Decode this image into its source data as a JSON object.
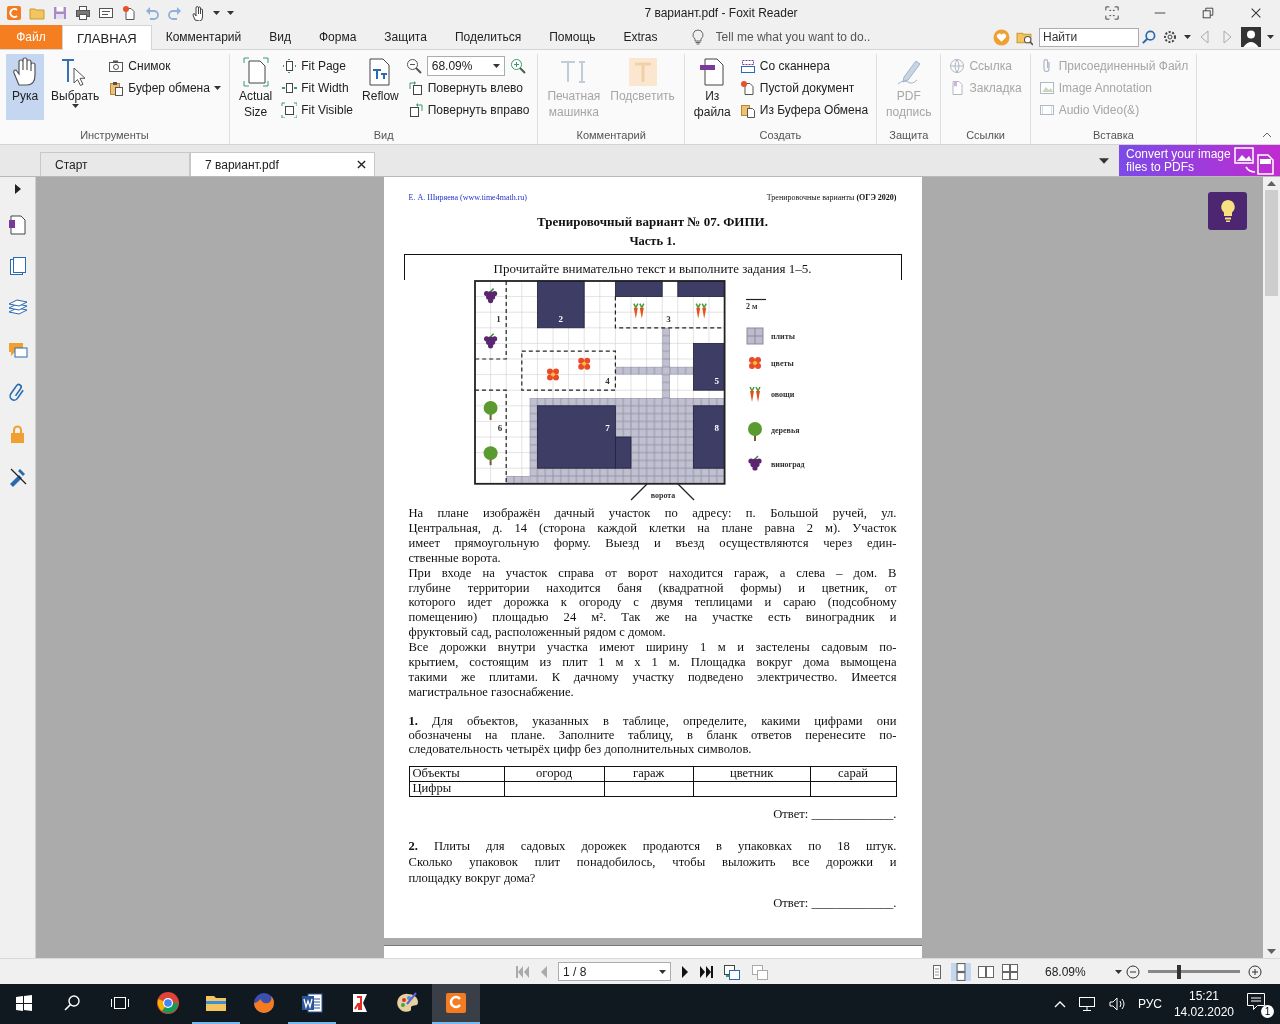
{
  "window": {
    "title": "7 вариант.pdf - Foxit Reader"
  },
  "menu_tabs": [
    {
      "label": "Файл",
      "kind": "file",
      "selected": false
    },
    {
      "label": "ГЛАВНАЯ",
      "kind": "tab",
      "selected": true
    },
    {
      "label": "Комментарий",
      "kind": "tab",
      "selected": false
    },
    {
      "label": "Вид",
      "kind": "tab",
      "selected": false
    },
    {
      "label": "Форма",
      "kind": "tab",
      "selected": false
    },
    {
      "label": "Защита",
      "kind": "tab",
      "selected": false
    },
    {
      "label": "Поделиться",
      "kind": "tab",
      "selected": false
    },
    {
      "label": "Помощь",
      "kind": "tab",
      "selected": false
    },
    {
      "label": "Extras",
      "kind": "tab",
      "selected": false
    }
  ],
  "tell_me": {
    "placeholder": "Tell me what you want to do.."
  },
  "search": {
    "placeholder": "Найти"
  },
  "ribbon_groups": [
    {
      "label": "Инструменты",
      "columns": [
        {
          "kind": "large",
          "items": [
            {
              "kind": "button",
              "label": "Рука",
              "selected": true,
              "disabled": false,
              "dropdown": false
            }
          ]
        },
        {
          "kind": "large",
          "items": [
            {
              "kind": "button",
              "label": "Выбрать",
              "selected": false,
              "disabled": false,
              "dropdown": true
            }
          ]
        },
        {
          "kind": "small",
          "items": [
            {
              "kind": "button",
              "label": "Снимок",
              "selected": false,
              "disabled": false,
              "dropdown": false
            },
            {
              "kind": "button",
              "label": "Буфер обмена",
              "selected": false,
              "disabled": false,
              "dropdown": true
            }
          ]
        }
      ]
    },
    {
      "label": "Вид",
      "columns": [
        {
          "kind": "large",
          "items": [
            {
              "kind": "button",
              "label": "Actual Size",
              "selected": false,
              "disabled": false,
              "dropdown": false
            }
          ]
        },
        {
          "kind": "small",
          "items": [
            {
              "kind": "button",
              "label": "Fit Page",
              "selected": false,
              "disabled": false,
              "dropdown": false
            },
            {
              "kind": "button",
              "label": "Fit Width",
              "selected": false,
              "disabled": false,
              "dropdown": false
            },
            {
              "kind": "button",
              "label": "Fit Visible",
              "selected": false,
              "disabled": false,
              "dropdown": false
            }
          ]
        },
        {
          "kind": "large",
          "items": [
            {
              "kind": "button",
              "label": "Reflow",
              "selected": false,
              "disabled": false,
              "dropdown": false
            }
          ]
        },
        {
          "kind": "small",
          "items": [
            {
              "kind": "combo",
              "value": "68.09%"
            },
            {
              "kind": "button",
              "label": "Повернуть влево",
              "selected": false,
              "disabled": false,
              "dropdown": false
            },
            {
              "kind": "button",
              "label": "Повернуть вправо",
              "selected": false,
              "disabled": false,
              "dropdown": false
            }
          ]
        }
      ]
    },
    {
      "label": "Комментарий",
      "columns": [
        {
          "kind": "large",
          "items": [
            {
              "kind": "button",
              "label": "Печатная машинка",
              "selected": false,
              "disabled": true,
              "dropdown": false
            }
          ]
        },
        {
          "kind": "large",
          "items": [
            {
              "kind": "button",
              "label": "Подсветить",
              "selected": false,
              "disabled": true,
              "dropdown": false
            }
          ]
        }
      ]
    },
    {
      "label": "Создать",
      "columns": [
        {
          "kind": "large",
          "items": [
            {
              "kind": "button",
              "label": "Из файла",
              "selected": false,
              "disabled": false,
              "dropdown": false
            }
          ]
        },
        {
          "kind": "small",
          "items": [
            {
              "kind": "button",
              "label": "Со сканнера",
              "selected": false,
              "disabled": false,
              "dropdown": false
            },
            {
              "kind": "button",
              "label": "Пустой документ",
              "selected": false,
              "disabled": false,
              "dropdown": false
            },
            {
              "kind": "button",
              "label": "Из Буфера Обмена",
              "selected": false,
              "disabled": false,
              "dropdown": false
            }
          ]
        }
      ]
    },
    {
      "label": "Защита",
      "columns": [
        {
          "kind": "large",
          "items": [
            {
              "kind": "button",
              "label": "PDF подпись",
              "selected": false,
              "disabled": true,
              "dropdown": false
            }
          ]
        }
      ]
    },
    {
      "label": "Ссылки",
      "columns": [
        {
          "kind": "small",
          "items": [
            {
              "kind": "button",
              "label": "Ссылка",
              "selected": false,
              "disabled": true,
              "dropdown": false
            },
            {
              "kind": "button",
              "label": "Закладка",
              "selected": false,
              "disabled": true,
              "dropdown": false
            }
          ]
        }
      ]
    },
    {
      "label": "Вставка",
      "columns": [
        {
          "kind": "small",
          "items": [
            {
              "kind": "button",
              "label": "Присоединенный Файл",
              "selected": false,
              "disabled": true,
              "dropdown": false
            },
            {
              "kind": "button",
              "label": "Image Annotation",
              "selected": false,
              "disabled": true,
              "dropdown": false
            },
            {
              "kind": "button",
              "label": "Audio  Video(&)",
              "selected": false,
              "disabled": true,
              "dropdown": false
            }
          ]
        }
      ]
    }
  ],
  "doc_tabs": [
    {
      "label": "Старт",
      "selected": false,
      "closable": false
    },
    {
      "label": "7 вариант.pdf",
      "selected": true,
      "closable": true
    }
  ],
  "promo": {
    "text": "Convert your image files to PDFs"
  },
  "document": {
    "header_left": "Е. А. Ширяева (www.time4math.ru)",
    "header_right": "Тренировочные варианты **(ОГЭ 2020)**",
    "title": "Тренировочный вариант № 07. ФИПИ.",
    "part": "Часть 1.",
    "instruction": "Прочитайте внимательно текст и выполните задания 1–5.",
    "plan": {
      "labels": [
        "1",
        "2",
        "3",
        "4",
        "5",
        "6",
        "7",
        "8"
      ],
      "gate": "ворота",
      "scale": "2 м",
      "legend": [
        {
          "kind": "tiles",
          "label": "плиты"
        },
        {
          "kind": "flowers",
          "label": "цветы"
        },
        {
          "kind": "vegetables",
          "label": "овощи"
        },
        {
          "kind": "trees",
          "label": "деревья"
        },
        {
          "kind": "grapes",
          "label": "виноград"
        }
      ]
    },
    "body": [
      {
        "kind": "paragraph",
        "lines": [
          "На плане изображён дачный участок по адресу: п. Большой ручей, ул.",
          "Центральная, д. 14 (сторона каждой клетки на плане равна 2 м). Участок",
          "имеет прямоугольную форму. Выезд и въезд осуществляются через един-",
          "ственные ворота."
        ]
      },
      {
        "kind": "paragraph",
        "lines": [
          "При входе на участок справа от ворот находится гараж, а слева – дом. В",
          "глубине территории находится баня (квадратной формы) и цветник, от",
          "которого идет дорожка к огороду с двумя теплицами и сараю (подсобному",
          "помещению) площадью 24 м². Так же на участке есть виноградник и",
          "фруктовый сад, расположенный рядом с домом."
        ]
      },
      {
        "kind": "paragraph",
        "lines": [
          "Все дорожки внутри участка имеют ширину 1 м и застелены садовым по-",
          "крытием, состоящим из плит 1 м х 1 м. Площадка вокруг дома вымощена",
          "такими же плитами. К дачному участку подведено электричество. Имеется",
          "магистральное газоснабжение."
        ]
      },
      {
        "kind": "question",
        "lines": [
          "**1.** Для объектов, указанных в таблице, определите, какими цифрами они",
          "обозначены на плане. Заполните таблицу, в бланк ответов перенесите по-",
          "следовательность четырёх цифр без дополнительных символов."
        ]
      },
      {
        "kind": "table",
        "columns": [
          "Объекты",
          "огород",
          "гараж",
          "цветник",
          "сарай"
        ],
        "rows": [
          {
            "label": "Цифры"
          }
        ]
      },
      {
        "kind": "answer",
        "text": "Ответ: _____________."
      },
      {
        "kind": "question",
        "lines": [
          "**2.** Плиты для садовых дорожек продаются в упаковках по 18 штук.",
          "Сколько упаковок плит понадобилось, чтобы выложить все дорожки и",
          "площадку вокруг дома?"
        ]
      },
      {
        "kind": "answer",
        "text": "Ответ: _____________."
      }
    ]
  },
  "status_bar": {
    "page": "1 / 8",
    "zoom": "68.09%",
    "zoom_slider": {
      "level": 0.32
    }
  },
  "taskbar": {
    "apps": [
      {
        "running": false,
        "selected": false
      },
      {
        "running": true,
        "selected": false
      },
      {
        "running": false,
        "selected": false
      },
      {
        "running": true,
        "selected": false
      },
      {
        "running": false,
        "selected": false
      },
      {
        "running": false,
        "selected": false
      },
      {
        "running": true,
        "selected": true
      }
    ],
    "language": "РУС",
    "time": "15:21",
    "date": "14.02.2020",
    "notifications": "1"
  }
}
